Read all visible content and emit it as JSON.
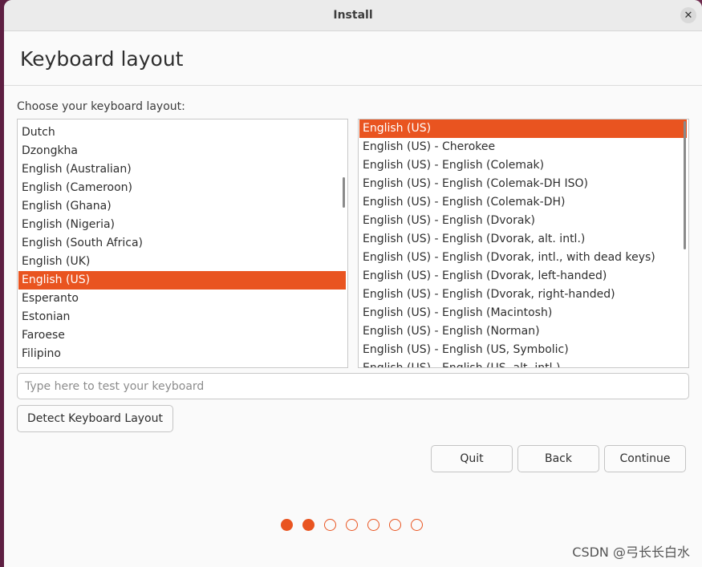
{
  "window": {
    "title": "Install",
    "close_glyph": "✕"
  },
  "header": {
    "title": "Keyboard layout"
  },
  "prompt": "Choose your keyboard layout:",
  "layouts": {
    "items": [
      "Dutch",
      "Dzongkha",
      "English (Australian)",
      "English (Cameroon)",
      "English (Ghana)",
      "English (Nigeria)",
      "English (South Africa)",
      "English (UK)",
      "English (US)",
      "Esperanto",
      "Estonian",
      "Faroese",
      "Filipino"
    ],
    "selected": "English (US)"
  },
  "variants": {
    "items": [
      "English (US)",
      "English (US) - Cherokee",
      "English (US) - English (Colemak)",
      "English (US) - English (Colemak-DH ISO)",
      "English (US) - English (Colemak-DH)",
      "English (US) - English (Dvorak)",
      "English (US) - English (Dvorak, alt. intl.)",
      "English (US) - English (Dvorak, intl., with dead keys)",
      "English (US) - English (Dvorak, left-handed)",
      "English (US) - English (Dvorak, right-handed)",
      "English (US) - English (Macintosh)",
      "English (US) - English (Norman)",
      "English (US) - English (US, Symbolic)",
      "English (US) - English (US, alt. intl.)"
    ],
    "selected": "English (US)"
  },
  "test_input": {
    "placeholder": "Type here to test your keyboard",
    "value": ""
  },
  "buttons": {
    "detect": "Detect Keyboard Layout",
    "quit": "Quit",
    "back": "Back",
    "continue": "Continue"
  },
  "progress": {
    "total_steps": 7,
    "completed_steps": 2
  },
  "watermark": "CSDN @弓长长白水",
  "colors": {
    "accent": "#e95420",
    "background": "#fafafa",
    "titlebar": "#ebebeb"
  },
  "icons": {
    "close": "close-icon"
  }
}
